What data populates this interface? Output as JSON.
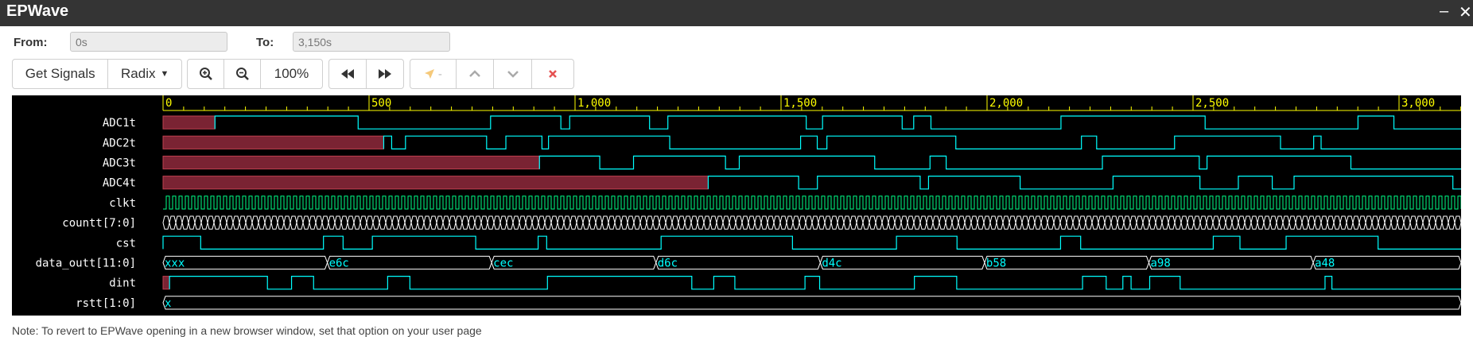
{
  "window": {
    "title": "EPWave",
    "minimize": "–",
    "close": "✕"
  },
  "range": {
    "from_label": "From:",
    "from_value": "0s",
    "to_label": "To:",
    "to_value": "3,150s"
  },
  "toolbar": {
    "get_signals": "Get Signals",
    "radix": "Radix",
    "zoom_level": "100%",
    "marker_value": "-"
  },
  "ruler": {
    "ticks": [
      "0",
      "500",
      "1,000",
      "1,500",
      "2,000",
      "2,500",
      "3,000"
    ]
  },
  "signals": [
    {
      "name": "ADC1t",
      "type": "bit"
    },
    {
      "name": "ADC2t",
      "type": "bit"
    },
    {
      "name": "ADC3t",
      "type": "bit"
    },
    {
      "name": "ADC4t",
      "type": "bit"
    },
    {
      "name": "clkt",
      "type": "clock"
    },
    {
      "name": "countt[7:0]",
      "type": "bus"
    },
    {
      "name": "cst",
      "type": "bit"
    },
    {
      "name": "data_outt[11:0]",
      "type": "bus",
      "values": [
        "xxx",
        "e6c",
        "cec",
        "d6c",
        "d4c",
        "b58",
        "a98",
        "a48"
      ]
    },
    {
      "name": "dint",
      "type": "bit"
    },
    {
      "name": "rstt[1:0]",
      "type": "bus",
      "values": [
        "x"
      ]
    }
  ],
  "colors": {
    "wave": "#00ffff",
    "bus_edge": "#ffffff",
    "undefined_fill": "#7a2333",
    "ruler": "#ffff00",
    "clock": "#00ff88"
  },
  "note": "Note: To revert to EPWave opening in a new browser window, set that option on your user page"
}
